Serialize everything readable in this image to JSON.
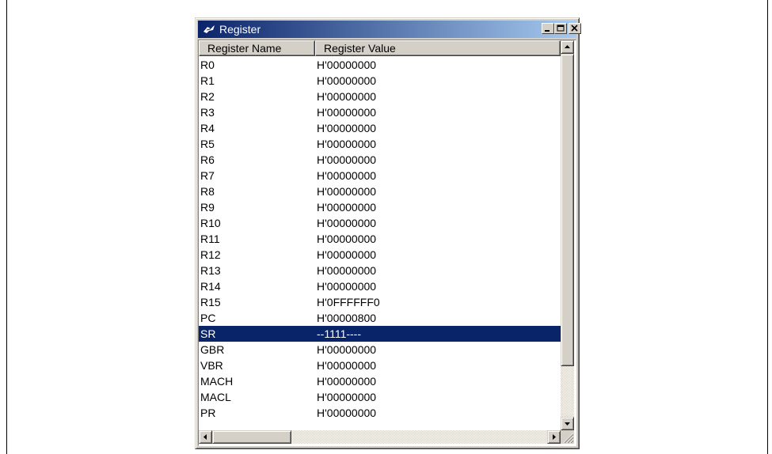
{
  "window": {
    "title": "Register",
    "controls": {
      "minimize": "_",
      "maximize": "□",
      "close": "✕"
    }
  },
  "table": {
    "columns": [
      "Register Name",
      "Register Value"
    ],
    "rows": [
      {
        "name": "R0",
        "value": "H'00000000"
      },
      {
        "name": "R1",
        "value": "H'00000000"
      },
      {
        "name": "R2",
        "value": "H'00000000"
      },
      {
        "name": "R3",
        "value": "H'00000000"
      },
      {
        "name": "R4",
        "value": "H'00000000"
      },
      {
        "name": "R5",
        "value": "H'00000000"
      },
      {
        "name": "R6",
        "value": "H'00000000"
      },
      {
        "name": "R7",
        "value": "H'00000000"
      },
      {
        "name": "R8",
        "value": "H'00000000"
      },
      {
        "name": "R9",
        "value": "H'00000000"
      },
      {
        "name": "R10",
        "value": "H'00000000"
      },
      {
        "name": "R11",
        "value": "H'00000000"
      },
      {
        "name": "R12",
        "value": "H'00000000"
      },
      {
        "name": "R13",
        "value": "H'00000000"
      },
      {
        "name": "R14",
        "value": "H'00000000"
      },
      {
        "name": "R15",
        "value": "H'0FFFFFF0"
      },
      {
        "name": "PC",
        "value": "H'00000800"
      },
      {
        "name": "SR",
        "value": "--1111----",
        "selected": true
      },
      {
        "name": "GBR",
        "value": "H'00000000"
      },
      {
        "name": "VBR",
        "value": "H'00000000"
      },
      {
        "name": "MACH",
        "value": "H'00000000"
      },
      {
        "name": "MACL",
        "value": "H'00000000"
      },
      {
        "name": "PR",
        "value": "H'00000000"
      }
    ]
  },
  "scroll": {
    "vertical_position": 0.0,
    "horizontal_position": 0.0
  },
  "colors": {
    "title_start": "#0a246a",
    "title_end": "#a6caf0",
    "selection": "#0a246a",
    "chrome": "#d4d0c8"
  }
}
